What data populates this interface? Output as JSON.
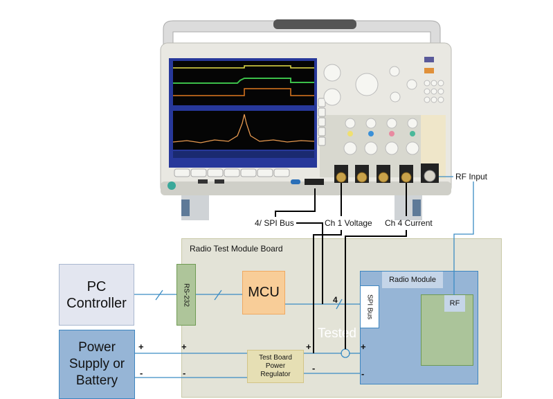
{
  "board": {
    "title": "Radio Test Module Board",
    "watermark": "Tested"
  },
  "blocks": {
    "pc": "PC Controller",
    "power": "Power Supply or Battery",
    "rs232": "RS-232",
    "mcu": "MCU",
    "regulator": "Test Board Power Regulator",
    "radio_module": "Radio Module",
    "spi_bus": "SPI Bus",
    "rf": "RF"
  },
  "probe_labels": {
    "spi": "4/ SPI Bus",
    "ch1": "Ch 1 Voltage",
    "ch4": "Ch 4 Current",
    "rf_input": "RF Input"
  },
  "bus_width": "4",
  "polarity": {
    "plus": "+",
    "minus": "-"
  },
  "colors": {
    "wire_blue": "#3a8cc4",
    "probe_black": "#000000",
    "board_fill": "#e3e3d7",
    "pc_fill": "#e3e6f0",
    "power_fill": "#96b5d6",
    "rs232_fill": "#aec59a",
    "mcu_fill": "#f8cd98",
    "regulator_fill": "#e6dfb4"
  }
}
